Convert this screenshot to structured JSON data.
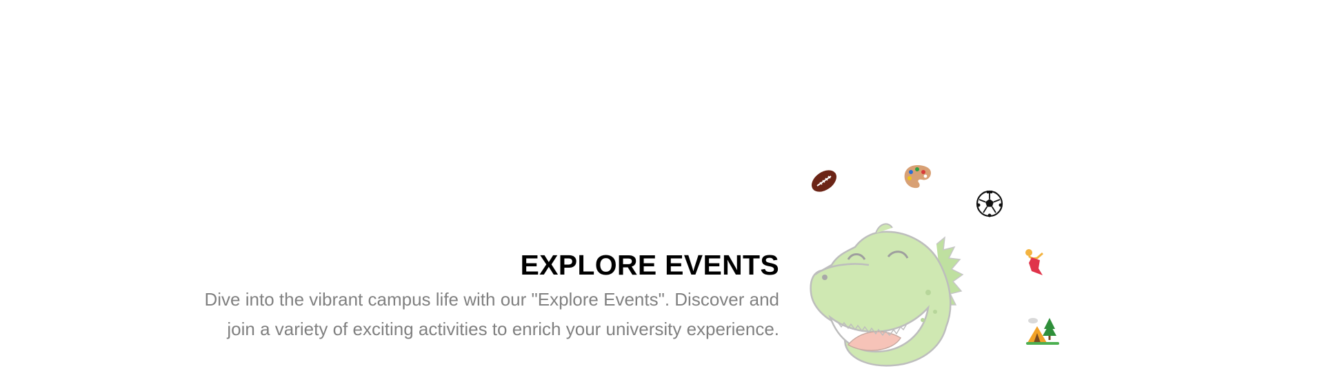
{
  "hero": {
    "title": "EXPLORE EVENTS",
    "description_line1": "Dive into the vibrant campus life with our \"Explore Events\". Discover and",
    "description_line2": "join a variety of exciting activities to enrich your university experience."
  },
  "icons": {
    "football": "football-icon",
    "palette": "art-palette-icon",
    "soccer": "soccer-ball-icon",
    "dancer": "dancer-icon",
    "tent": "camping-tent-icon",
    "mascot": "dinosaur-mascot-icon"
  },
  "colors": {
    "title": "#000000",
    "description": "#808080",
    "mascot_green": "#c9e5a6",
    "mascot_outline": "#b7b7b7",
    "mascot_mouth": "#f6c3b8"
  }
}
